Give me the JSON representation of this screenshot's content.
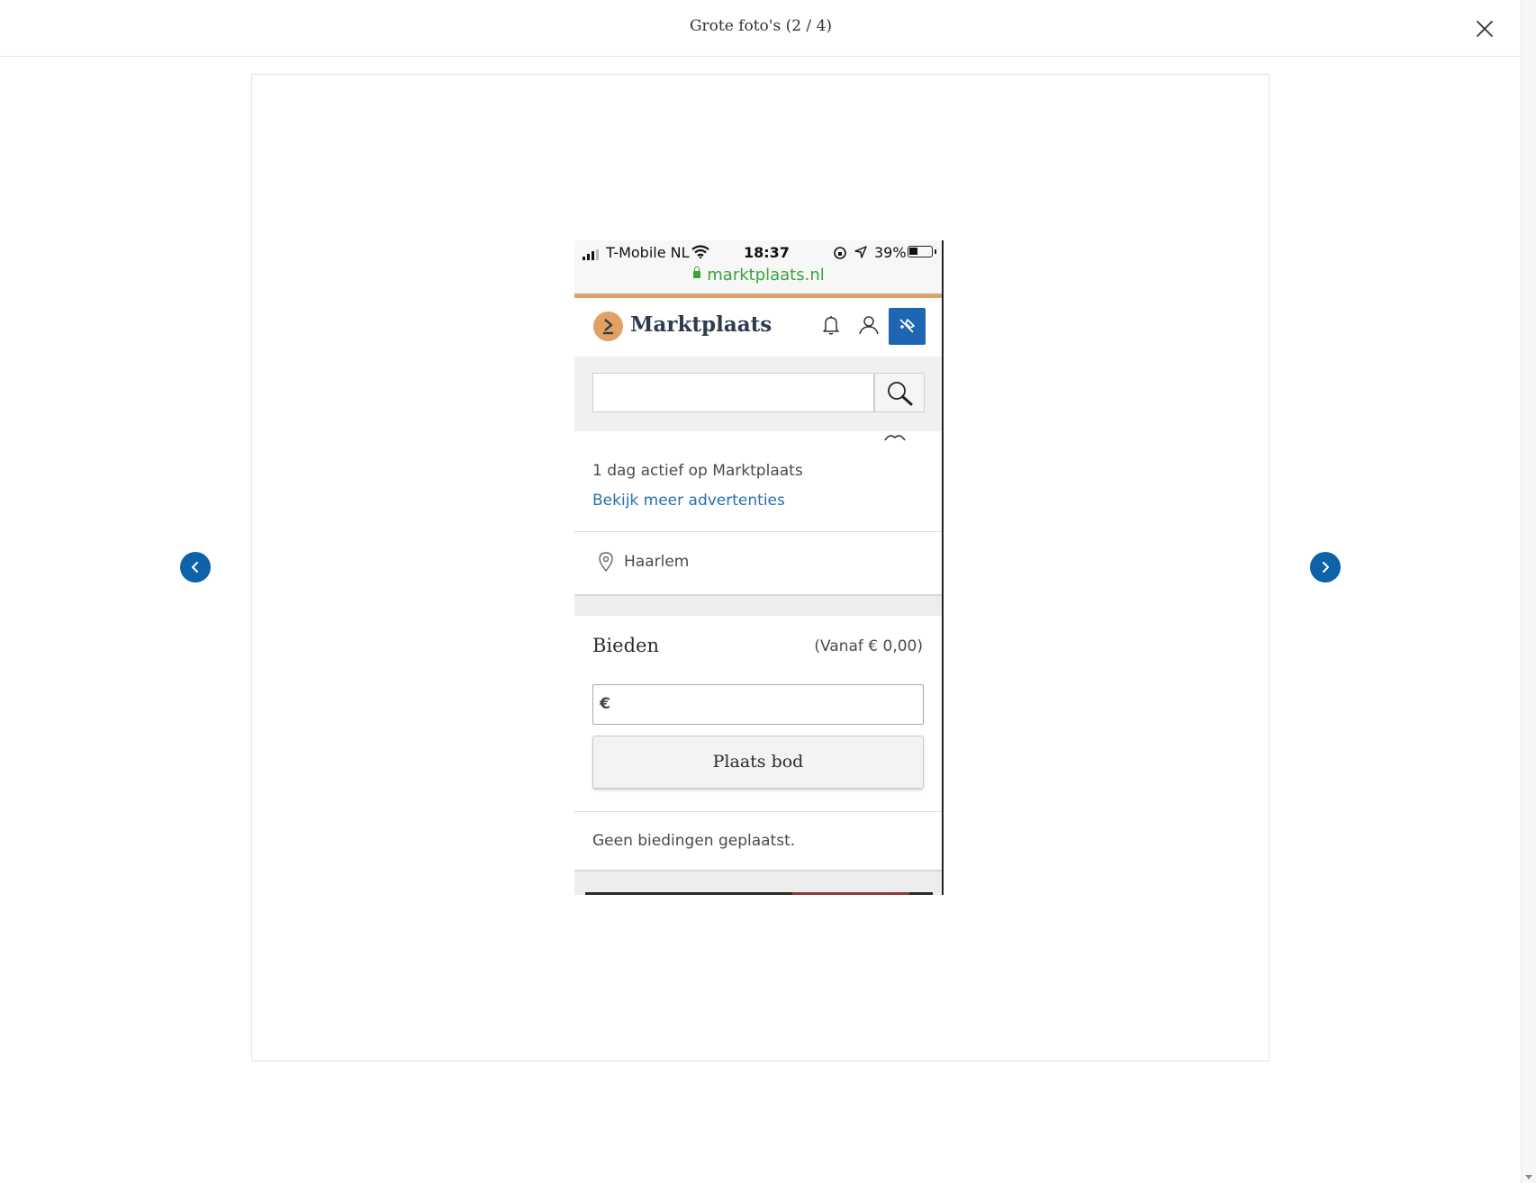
{
  "modal": {
    "title": "Grote foto's (2 / 4)"
  },
  "screenshot": {
    "status_bar": {
      "carrier": "T-Mobile NL",
      "time": "18:37",
      "battery_percent": "39%",
      "battery_level": 0.39,
      "url": "marktplaats.nl"
    },
    "header": {
      "brand": "Marktplaats"
    },
    "seller": {
      "active_text": "1 dag actief op Marktplaats",
      "more_ads_link": "Bekijk meer advertenties"
    },
    "location": "Haarlem",
    "bidding": {
      "title": "Bieden",
      "from_text": "(Vanaf € 0,00)",
      "currency_symbol": "€",
      "place_bid_button": "Plaats bod",
      "no_bids_text": "Geen biedingen geplaatst."
    }
  },
  "colors": {
    "nav_button": "#0e62a8",
    "brand_orange": "#dca26c",
    "link_blue": "#2870ac",
    "url_green": "#3aa33a"
  },
  "icons": {
    "close": "close-icon",
    "prev": "chevron-left-icon",
    "next": "chevron-right-icon"
  }
}
